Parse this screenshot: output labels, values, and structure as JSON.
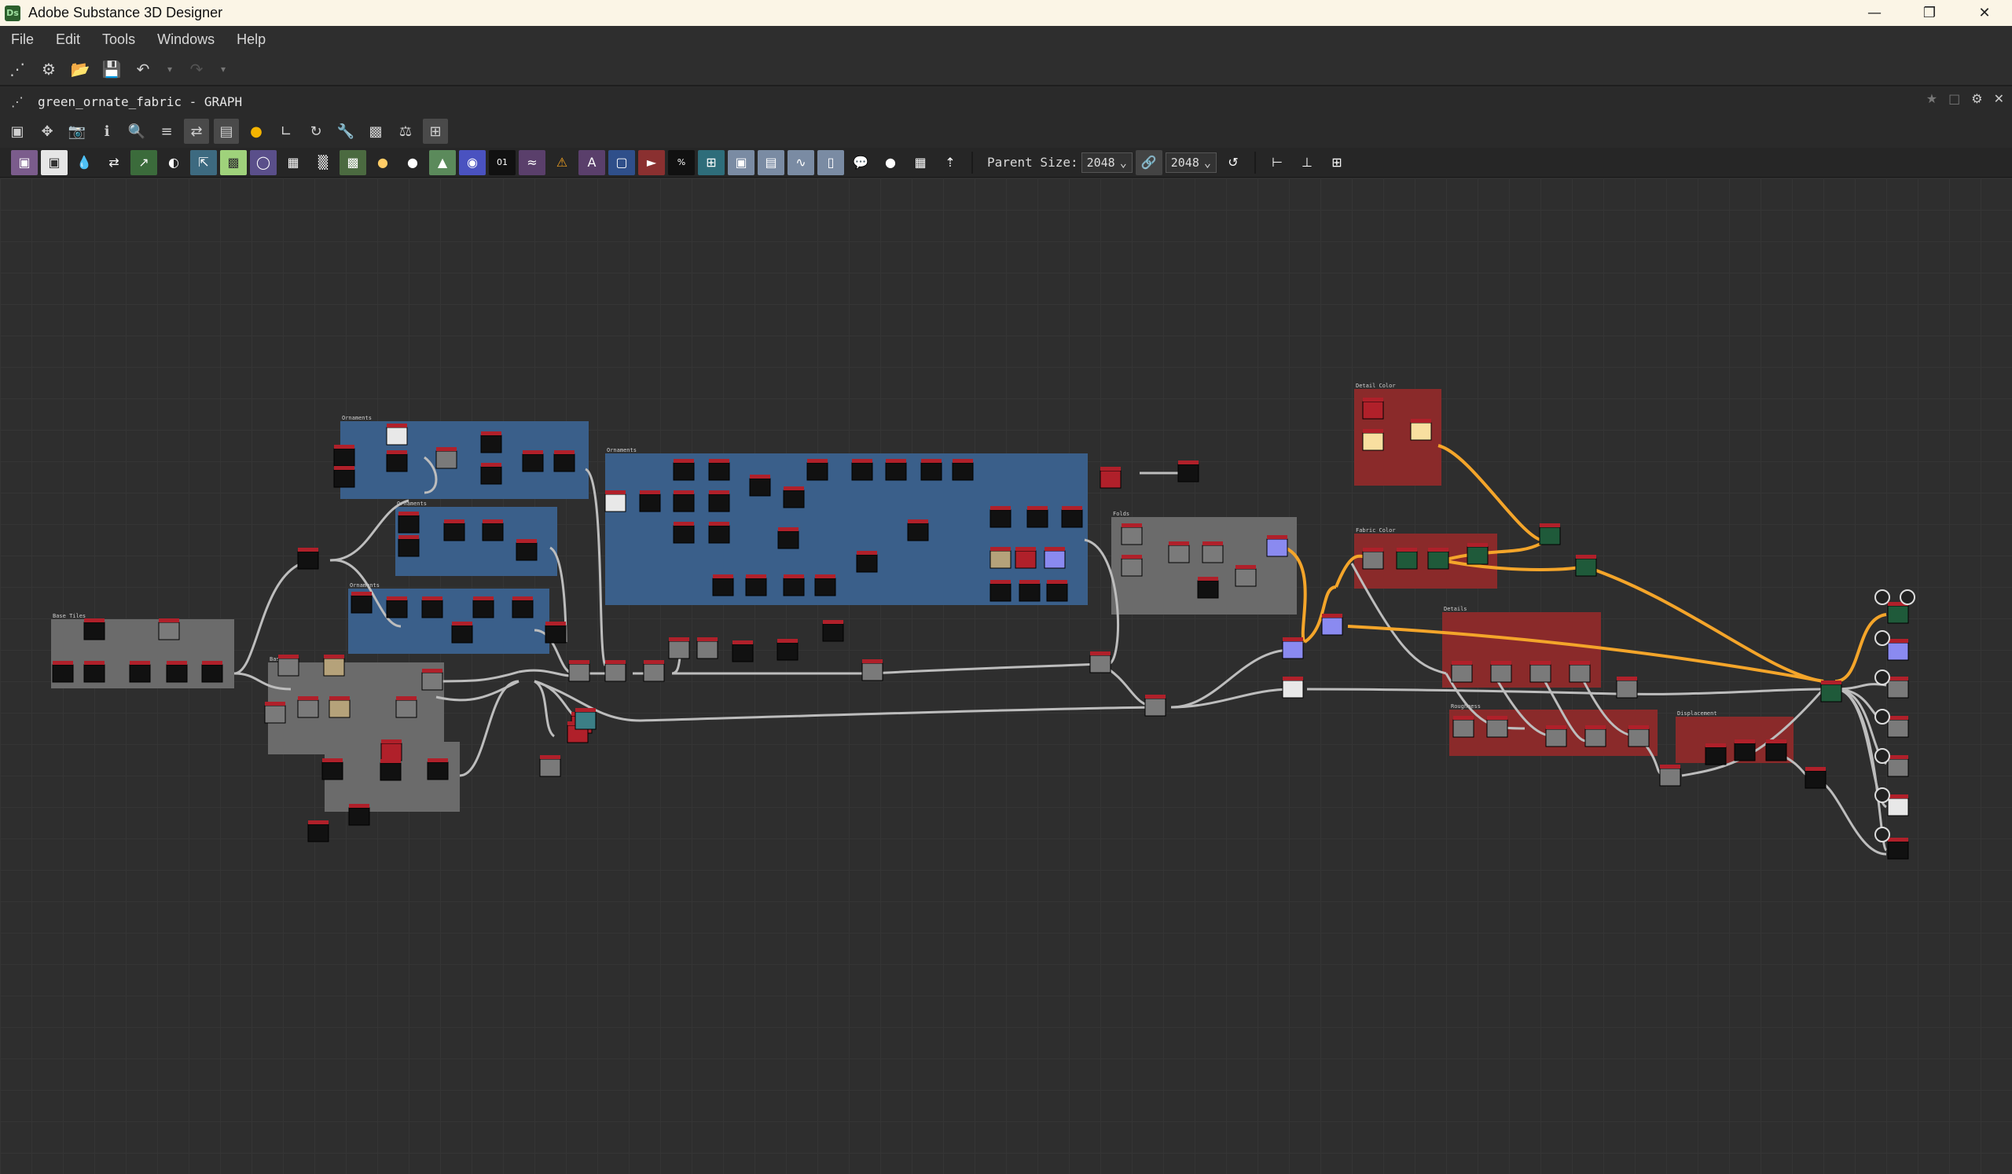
{
  "window": {
    "app_icon": "Ds",
    "title": "Adobe Substance 3D Designer",
    "controls": [
      "minimize-icon",
      "restore-icon",
      "close-icon"
    ]
  },
  "menu": [
    "File",
    "Edit",
    "Tools",
    "Windows",
    "Help"
  ],
  "main_toolbar": [
    "graph-explorer-icon",
    "new-package-icon",
    "open-icon",
    "save-icon",
    "undo-icon",
    "redo-icon"
  ],
  "graph": {
    "title": "green_ornate_fabric - GRAPH",
    "parent_size_label": "Parent Size:",
    "parent_size_value": "2048",
    "size_value": "2048"
  },
  "frames": [
    "Base Tiles",
    "Base Yarn",
    "Ornaments",
    "Ornaments",
    "Ornaments",
    "Ornaments",
    "Folds",
    "Detail Color",
    "Fabric Color",
    "Details",
    "Roughness",
    "Displacement"
  ],
  "colors": {
    "frame_blue": "#3a5f8a",
    "frame_gray": "#6b6b6b",
    "frame_red": "#8a2a2a",
    "link_gray": "#bdbdbd",
    "link_orange": "#f4a52a",
    "node_dark": "#111111",
    "node_header_red": "#b0202a"
  }
}
